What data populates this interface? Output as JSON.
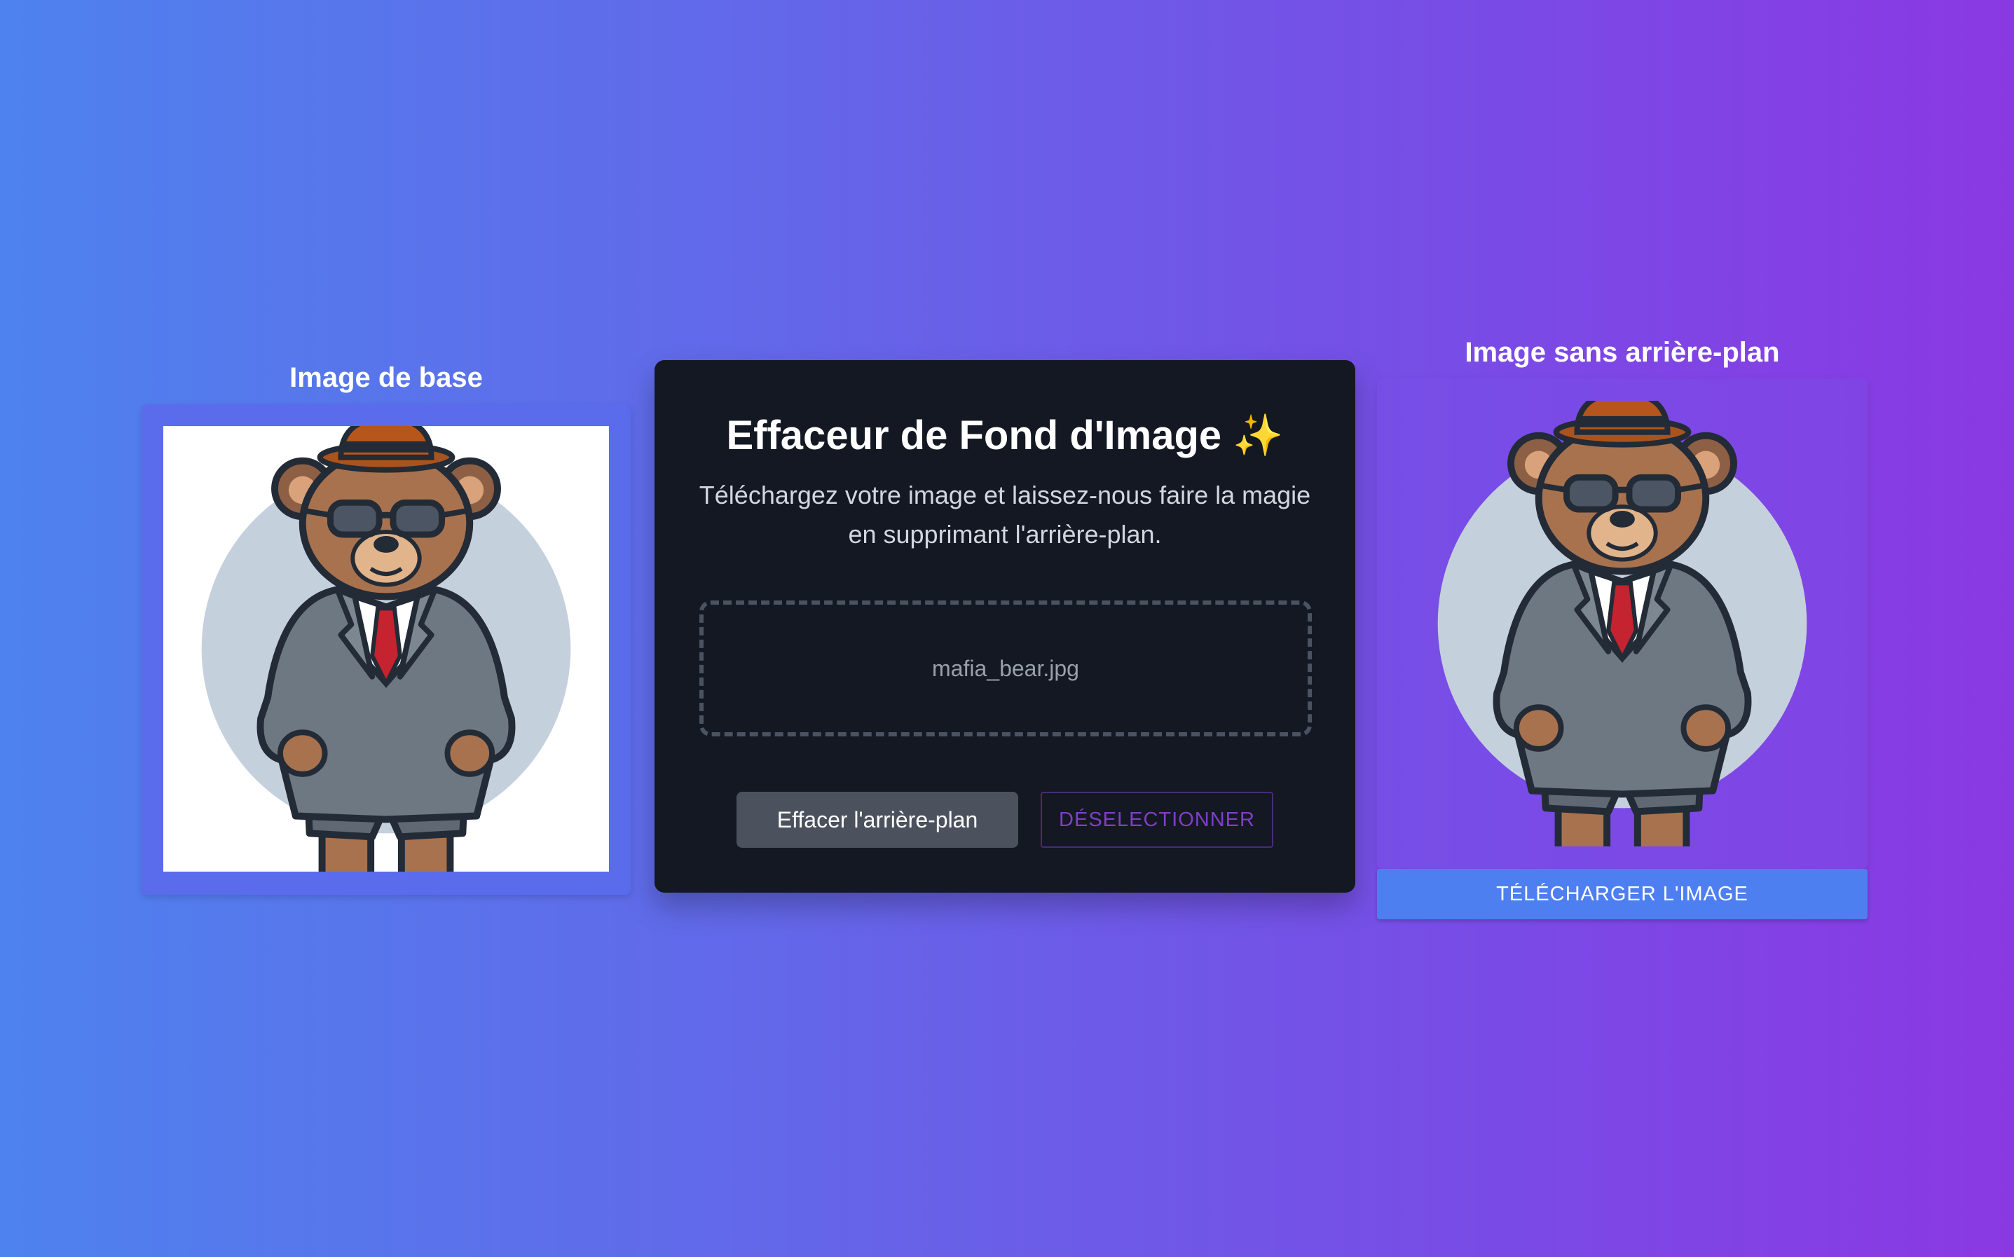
{
  "original_panel": {
    "title": "Image de base"
  },
  "main_panel": {
    "title": "Effaceur de Fond d'Image ✨",
    "description": "Téléchargez votre image et laissez-nous faire la magie en supprimant l'arrière-plan.",
    "file_name": "mafia_bear.jpg",
    "remove_button_label": "Effacer l'arrière-plan",
    "deselect_button_label": "DÉSELECTIONNER"
  },
  "result_panel": {
    "title": "Image sans arrière-plan",
    "download_button_label": "TÉLÉCHARGER L'IMAGE"
  },
  "colors": {
    "panel_bg": "#131822",
    "remove_button": "#4b525e",
    "deselect_text": "#7f3fc4",
    "download_button": "#4e7ff0"
  }
}
